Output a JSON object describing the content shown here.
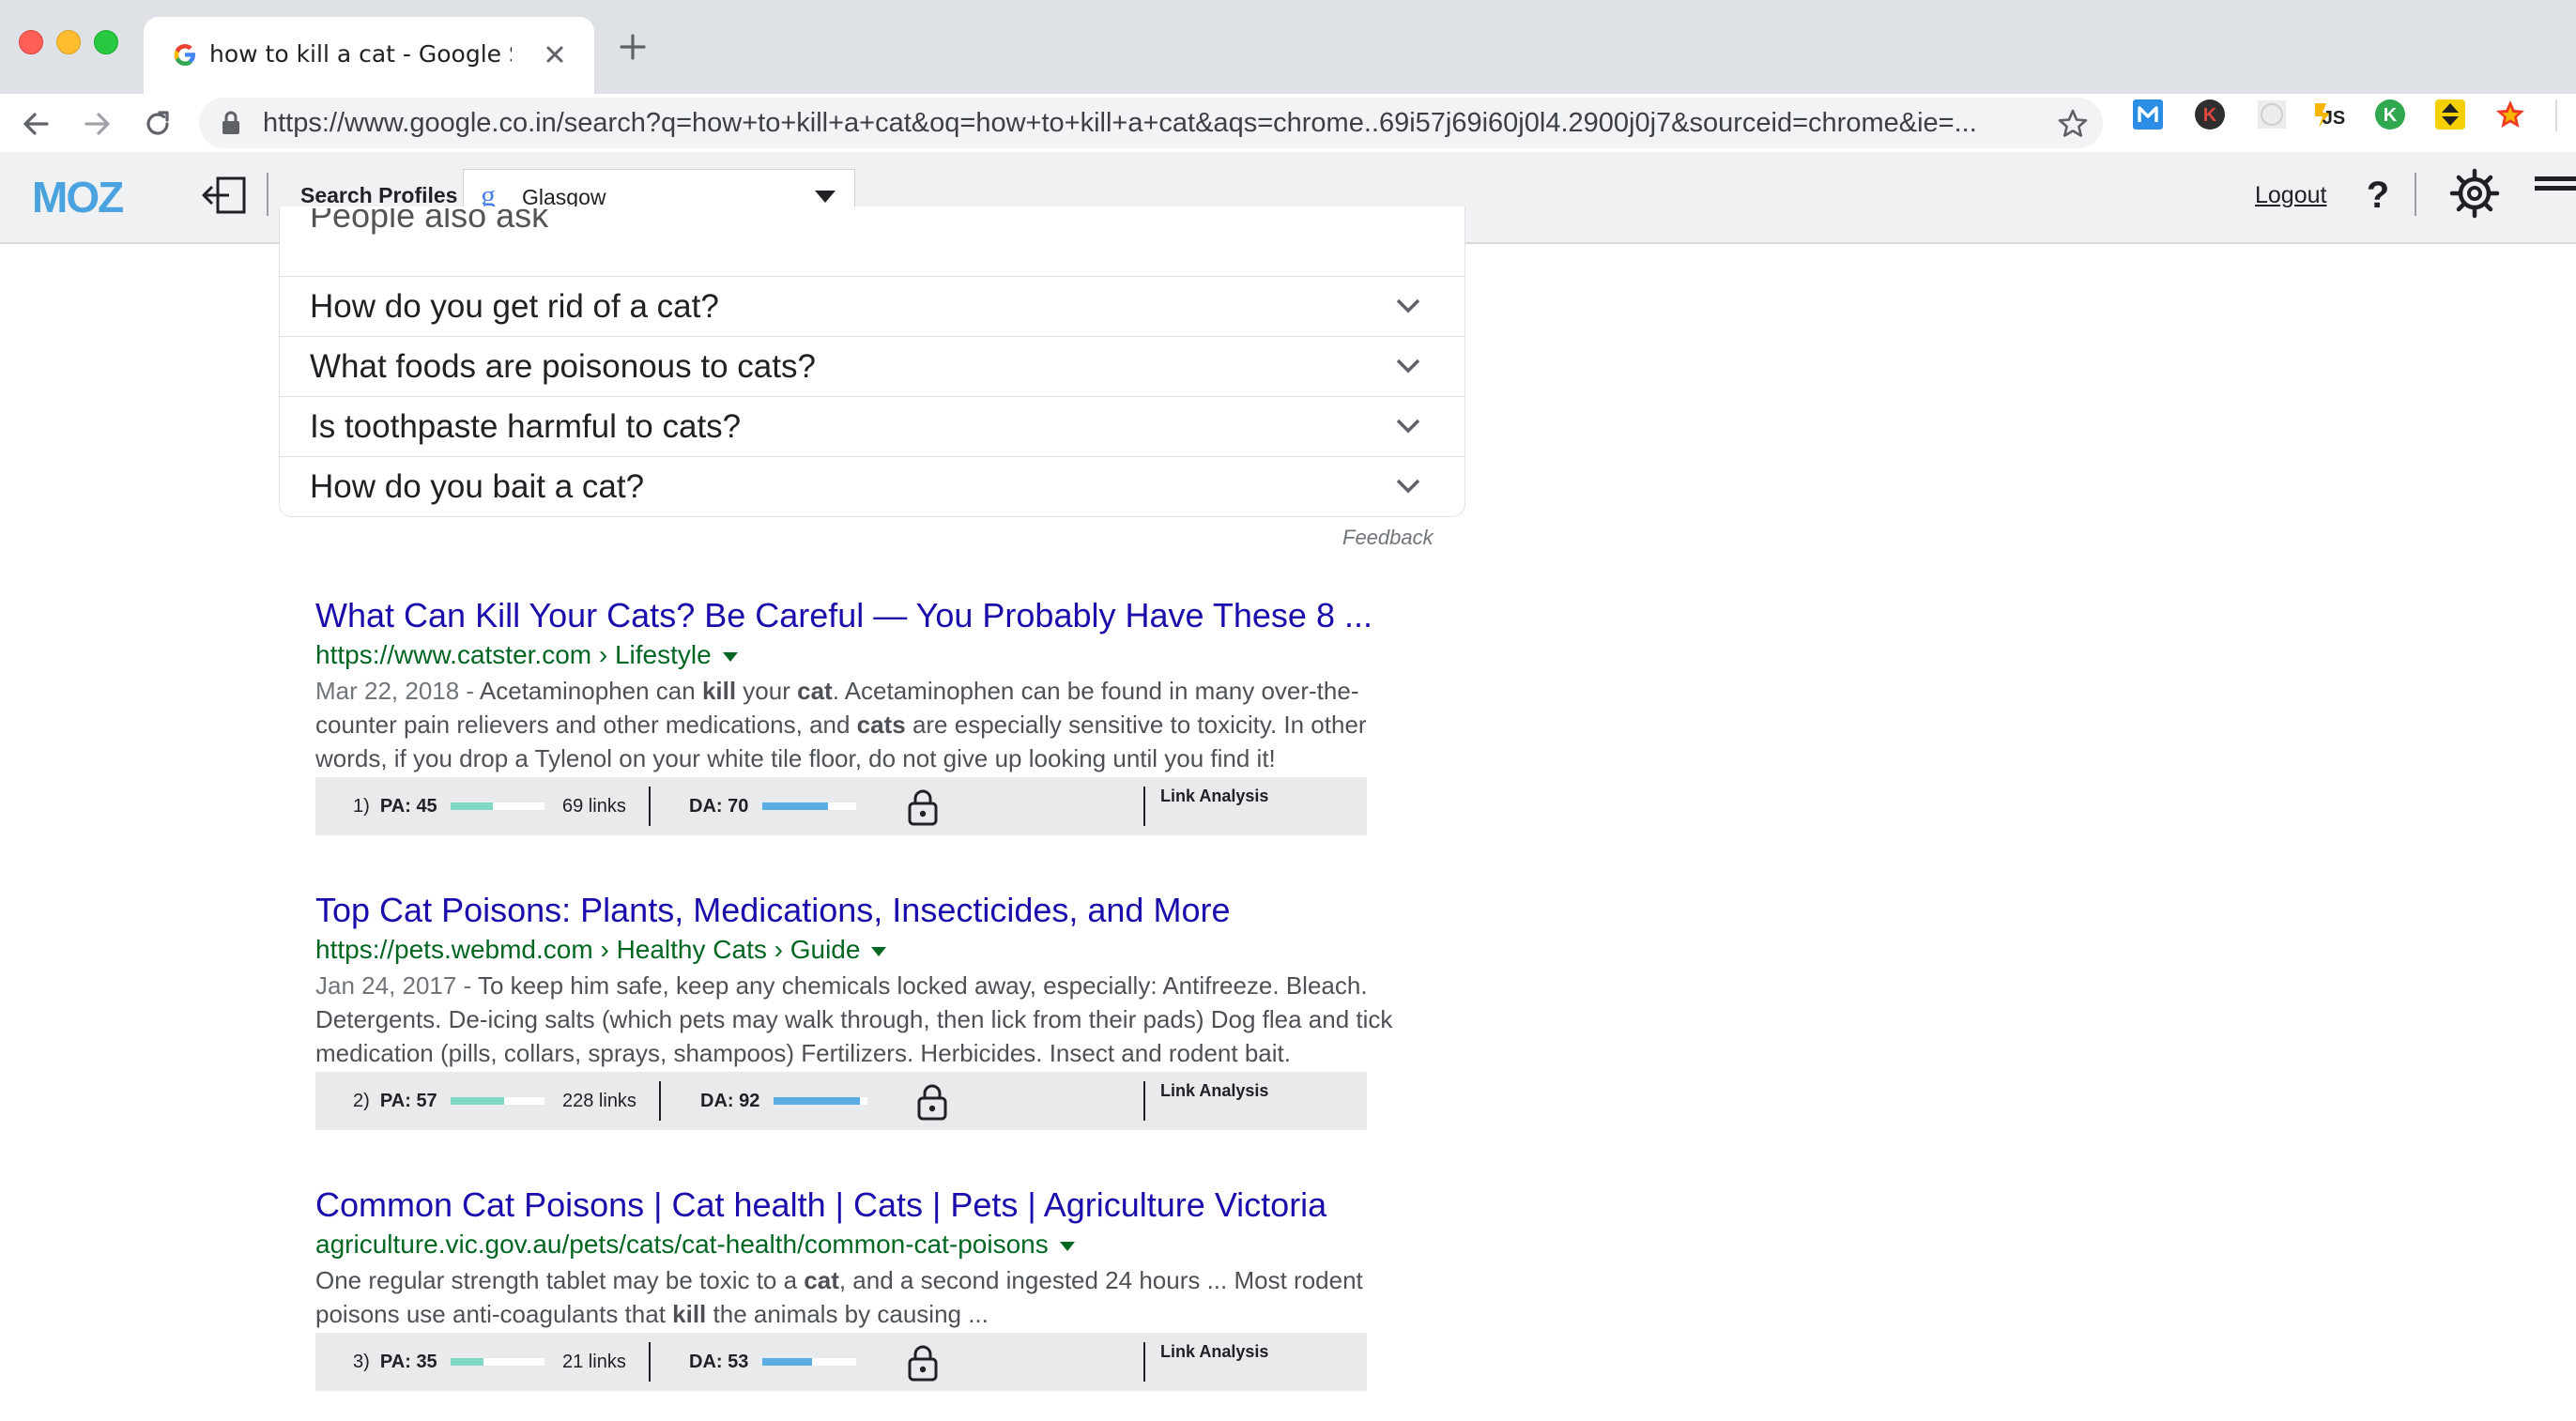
{
  "browser": {
    "tab_title": "how to kill a cat - Google Search",
    "url": "https://www.google.co.in/search?q=how+to+kill+a+cat&oq=how+to+kill+a+cat&aqs=chrome..69i57j69i60j0l4.2900j0j7&sourceid=chrome&ie=...",
    "new_tab_symbol": "+",
    "close_symbol": "×"
  },
  "mozbar": {
    "logo_text": "MOZ",
    "search_profiles_label": "Search Profiles",
    "profile_value": "Glasgow",
    "logout_label": "Logout",
    "help_label": "?"
  },
  "people_also_ask": {
    "heading": "People also ask",
    "questions": [
      "How do you get rid of a cat?",
      "What foods are poisonous to cats?",
      "Is toothpaste harmful to cats?",
      "How do you bait a cat?"
    ],
    "feedback_label": "Feedback"
  },
  "results": [
    {
      "title": "What Can Kill Your Cats? Be Careful — You Probably Have These 8 ...",
      "url": "https://www.catster.com › Lifestyle",
      "date": "Mar 22, 2018 - ",
      "snippet": [
        {
          "t": "Acetaminophen can "
        },
        {
          "b": "kill"
        },
        {
          "t": " your "
        },
        {
          "b": "cat"
        },
        {
          "t": ". Acetaminophen can be found in many over-the-counter pain relievers and other medications, and "
        },
        {
          "b": "cats"
        },
        {
          "t": " are especially sensitive to toxicity. In other words, if you drop a Tylenol on your white tile floor, do not give up looking until you find it!"
        }
      ],
      "metrics": {
        "rank": "1)",
        "pa_label": "PA: 45",
        "pa_value": 45,
        "links": "69 links",
        "da_label": "DA: 70",
        "da_value": 70,
        "link_analysis": "Link Analysis"
      }
    },
    {
      "title": "Top Cat Poisons: Plants, Medications, Insecticides, and More",
      "url": "https://pets.webmd.com › Healthy Cats › Guide",
      "date": "Jan 24, 2017 - ",
      "snippet": [
        {
          "t": "To keep him safe, keep any chemicals locked away, especially: Antifreeze. Bleach. Detergents. De-icing salts (which pets may walk through, then lick from their pads) Dog flea and tick medication (pills, collars, sprays, shampoos) Fertilizers. Herbicides. Insect and rodent bait."
        }
      ],
      "metrics": {
        "rank": "2)",
        "pa_label": "PA: 57",
        "pa_value": 57,
        "links": "228 links",
        "da_label": "DA: 92",
        "da_value": 92,
        "link_analysis": "Link Analysis"
      }
    },
    {
      "title": "Common Cat Poisons | Cat health | Cats | Pets | Agriculture Victoria",
      "url": "agriculture.vic.gov.au/pets/cats/cat-health/common-cat-poisons",
      "date": "",
      "snippet": [
        {
          "t": "One regular strength tablet may be toxic to a "
        },
        {
          "b": "cat"
        },
        {
          "t": ", and a second ingested 24 hours ... Most rodent poisons use anti-coagulants that "
        },
        {
          "b": "kill"
        },
        {
          "t": " the animals by causing ..."
        }
      ],
      "metrics": {
        "rank": "3)",
        "pa_label": "PA: 35",
        "pa_value": 35,
        "links": "21 links",
        "da_label": "DA: 53",
        "da_value": 53,
        "link_analysis": "Link Analysis"
      }
    }
  ],
  "colors": {
    "pa_bar": "#7fd9c4",
    "da_bar": "#5aaee3",
    "link": "#1a0dab",
    "url_green": "#006621"
  }
}
